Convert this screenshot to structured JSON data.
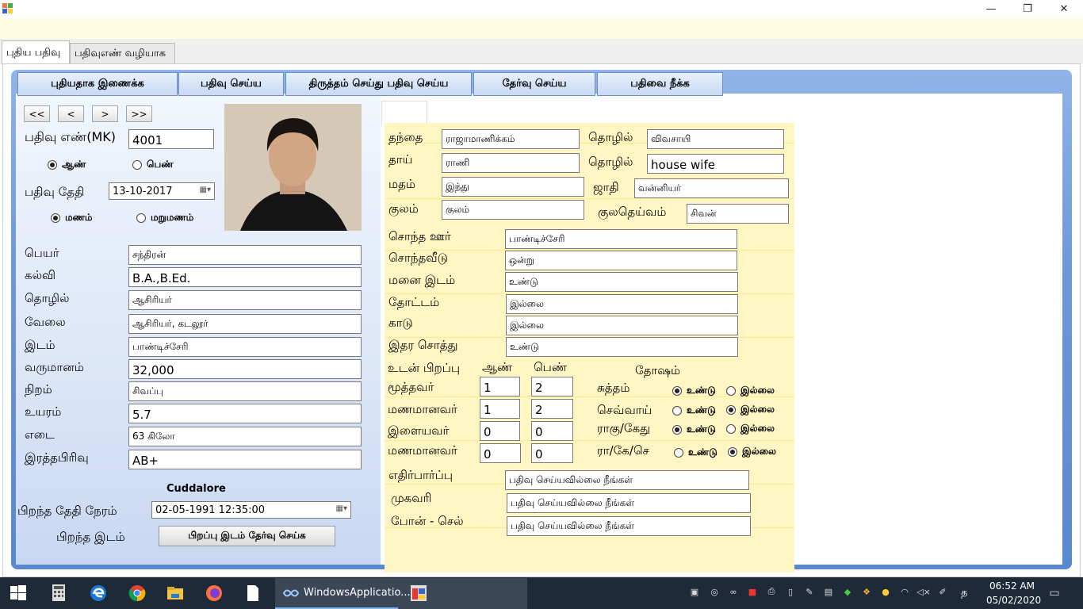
{
  "window": {
    "minimize_glyph": "—",
    "restore_glyph": "❐",
    "close_glyph": "✕"
  },
  "tabs": [
    "புதிய பதிவு",
    "பதிவுஎண் வழியாக"
  ],
  "toolbar": [
    "புதியதாக இணைக்க",
    "பதிவு செய்ய",
    "திருத்தம் செய்து பதிவு செய்ய",
    "தேர்வு செய்ய",
    "பதிவை நீக்க"
  ],
  "nav": [
    "<<",
    "<",
    ">",
    ">>"
  ],
  "left": {
    "reg_label": "பதிவு எண்(MK)",
    "reg_value": "4001",
    "gender": {
      "male": "ஆண்",
      "female": "பெண்",
      "selected": "male"
    },
    "date_label": "பதிவு தேதி",
    "date_value": "13-10-2017",
    "marriage": {
      "first": "மணம்",
      "re": "மறுமணம்",
      "selected": "first"
    },
    "fields": [
      {
        "label": "பெயர்",
        "value": "சந்திரன்"
      },
      {
        "label": "கல்வி",
        "value": "B.A.,B.Ed."
      },
      {
        "label": "தொழில்",
        "value": "ஆசிரியர்"
      },
      {
        "label": "வேலை",
        "value": "ஆசிரியர், கடலூர்"
      },
      {
        "label": "இடம்",
        "value": "பாண்டிச்சேரி"
      },
      {
        "label": "வருமானம்",
        "value": "32,000"
      },
      {
        "label": "நிறம்",
        "value": "சிவப்பு"
      },
      {
        "label": "உயரம்",
        "value": "5.7"
      },
      {
        "label": "எடை",
        "value": "63 கிலோ"
      },
      {
        "label": "இரத்தபிரிவு",
        "value": "AB+"
      }
    ],
    "city": "Cuddalore",
    "birth_label": "பிறந்த தேதி நேரம்",
    "birth_value": "02-05-1991 12:35:00",
    "birthplace_label": "பிறந்த இடம்",
    "birthplace_button": "பிறப்பு இடம் தேர்வு செய்க"
  },
  "right": {
    "father_label": "தந்தை",
    "father": "ராஜாமாணிக்கம்",
    "job_label": "தொழில்",
    "father_job": "விவசாயி",
    "mother_label": "தாய்",
    "mother": "ராணி",
    "mother_job": "house wife",
    "religion_label": "மதம்",
    "religion": "இந்து",
    "caste_label": "ஜாதி",
    "caste": "வன்னியர்",
    "clan_label": "குலம்",
    "clan": "குலம்",
    "deity_label": "குலதெய்வம்",
    "deity": "சிவன்",
    "props": [
      {
        "label": "சொந்த ஊர்",
        "value": "பாண்டிச்சேரி"
      },
      {
        "label": "சொந்தவீடு",
        "value": "ஒன்று"
      },
      {
        "label": "மனை இடம்",
        "value": "உண்டு"
      },
      {
        "label": "தோட்டம்",
        "value": "இல்லை"
      },
      {
        "label": "காடு",
        "value": "இல்லை"
      },
      {
        "label": "இதர சொத்து",
        "value": "உண்டு"
      }
    ],
    "siblings_label": "உடன் பிறப்பு",
    "male_label": "ஆண்",
    "female_label": "பெண்",
    "dosham_label": "தோஷம்",
    "siblings": [
      {
        "label": "மூத்தவர்",
        "male": "1",
        "female": "2"
      },
      {
        "label": "மணமானவர்",
        "male": "1",
        "female": "2"
      },
      {
        "label": "இளையவர்",
        "male": "0",
        "female": "0"
      },
      {
        "label": "மணமானவர்",
        "male": "0",
        "female": "0"
      }
    ],
    "yes": "உண்டு",
    "no": "இல்லை",
    "dosham": [
      {
        "label": "சுத்தம்",
        "selected": "yes"
      },
      {
        "label": "செவ்வாய்",
        "selected": "no"
      },
      {
        "label": "ராகு/கேது",
        "selected": "yes"
      },
      {
        "label": "ரா/கே/செ",
        "selected": "no"
      }
    ],
    "expect_label": "எதிர்பார்ப்பு",
    "expect": "பதிவு செய்யவில்லை நீங்கள்",
    "address_label": "முகவரி",
    "address": "பதிவு செய்யவில்லை நீங்கள்",
    "phone_label": "போன் - செல்",
    "phone": "பதிவு செய்யவில்லை நீங்கள்"
  },
  "taskbar": {
    "app_label": "WindowsApplicatio...",
    "time": "06:52 AM",
    "date": "05/02/2020",
    "lang": "த"
  }
}
